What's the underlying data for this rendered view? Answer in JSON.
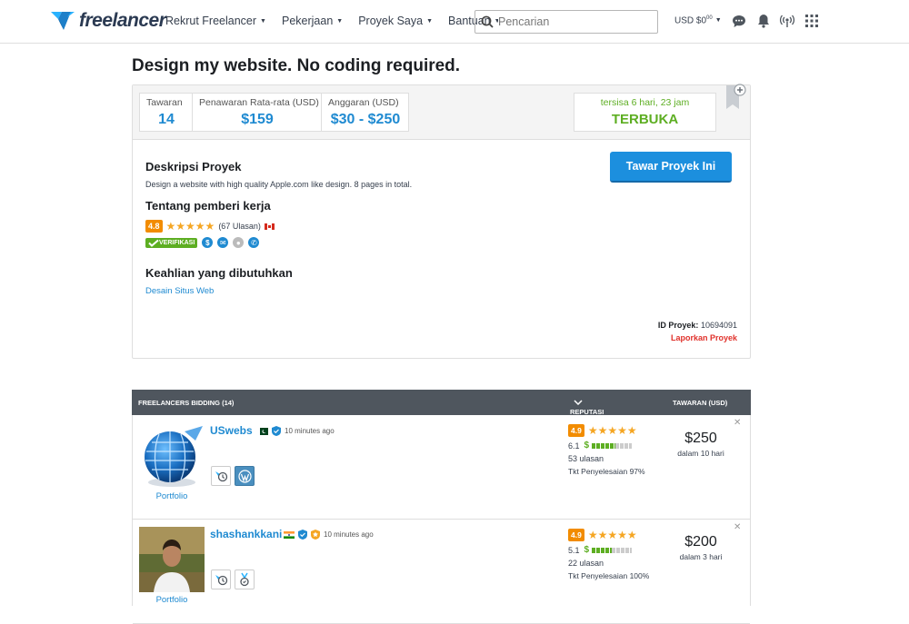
{
  "nav": {
    "logo": "freelancer",
    "menu": [
      "Rekrut Freelancer",
      "Pekerjaan",
      "Proyek Saya",
      "Bantuan"
    ],
    "search_placeholder": "Pencarian",
    "balance": "USD $0",
    "balance_cents": "00"
  },
  "project": {
    "title": "Design my website. No coding required.",
    "stats": [
      {
        "label": "Tawaran",
        "value": "14"
      },
      {
        "label": "Penawaran Rata-rata (USD)",
        "value": "$159"
      },
      {
        "label": "Anggaran (USD)",
        "value": "$30 - $250"
      }
    ],
    "time_left": "tersisa 6 hari, 23 jam",
    "status": "TERBUKA",
    "description_heading": "Deskripsi Proyek",
    "description": "Design a website with high quality Apple.com like design. 8 pages in total.",
    "bid_button": "Tawar Proyek Ini",
    "employer_heading": "Tentang pemberi kerja",
    "employer_rating": "4.8",
    "employer_reviews": "(67 Ulasan)",
    "verified_label": "VERIFIKASI",
    "skills_heading": "Keahlian yang dibutuhkan",
    "skill": "Desain Situs Web",
    "id_label": "ID Proyek:",
    "id_value": "10694091",
    "report": "Laporkan Proyek"
  },
  "bids": {
    "header_left": "FREELANCERS BIDDING (14)",
    "header_rep": "REPUTASI",
    "header_bid": "TAWARAN (USD)",
    "rows": [
      {
        "username": "USwebs",
        "time": "10 minutes ago",
        "portfolio": "Portfolio",
        "rating": "4.9",
        "earn_score": "6.1",
        "earn_level": 0.6,
        "reviews": "53 ulasan",
        "completion": "Tkt Penyelesaian 97%",
        "price": "$250",
        "days": "dalam 10 hari"
      },
      {
        "username": "shashankkani",
        "time": "10 minutes ago",
        "portfolio": "Portfolio",
        "rating": "4.9",
        "earn_score": "5.1",
        "earn_level": 0.5,
        "reviews": "22 ulasan",
        "completion": "Tkt Penyelesaian 100%",
        "price": "$200",
        "days": "dalam 3 hari"
      }
    ]
  },
  "colors": {
    "accent": "#1f8ad1",
    "success": "#5dae22",
    "rating": "#f28c00",
    "danger": "#e0312b",
    "header_dark": "#4f565e"
  }
}
